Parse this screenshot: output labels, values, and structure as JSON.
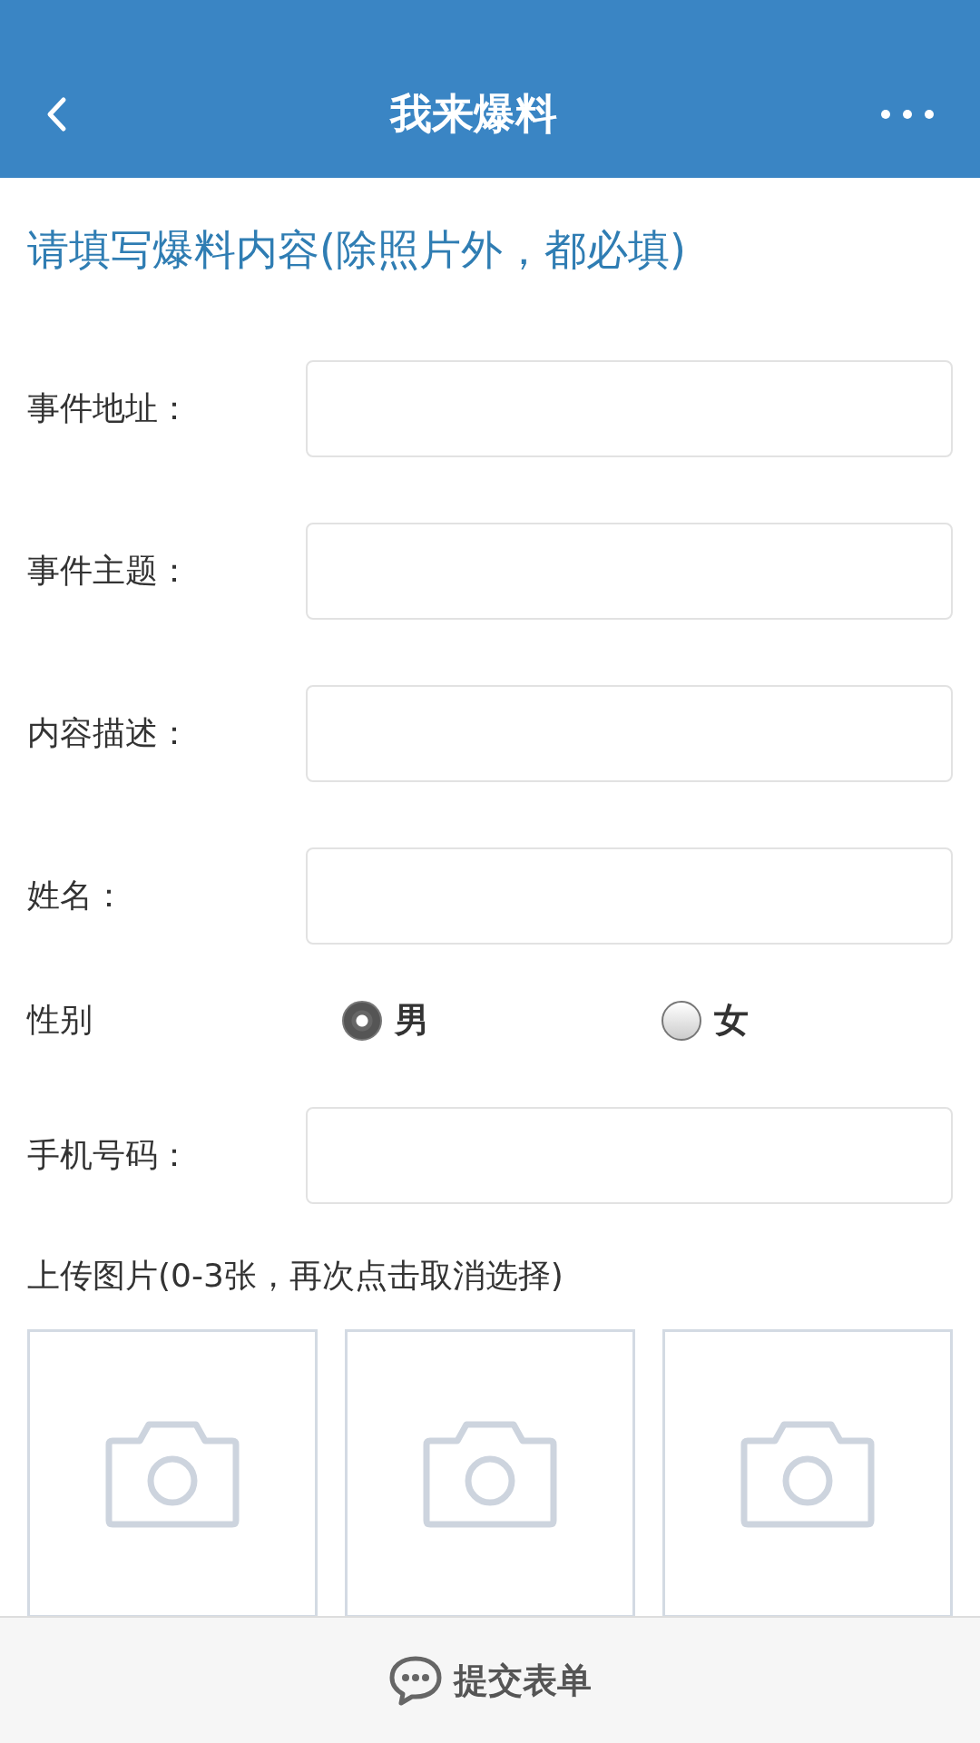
{
  "header": {
    "title": "我来爆料"
  },
  "form": {
    "heading": "请填写爆料内容(除照片外，都必填)",
    "fields": [
      {
        "kind": "text",
        "label": "事件地址："
      },
      {
        "kind": "text",
        "label": "事件主题："
      },
      {
        "kind": "text",
        "label": "内容描述："
      },
      {
        "kind": "text",
        "label": "姓名："
      },
      {
        "kind": "radio",
        "label": "性别",
        "options": [
          {
            "label": "男",
            "selected": true
          },
          {
            "label": "女",
            "selected": false
          }
        ]
      },
      {
        "kind": "text",
        "label": "手机号码："
      }
    ],
    "upload": {
      "label": "上传图片(0-3张，再次点击取消选择)",
      "slots": [
        {
          "kind": "camera"
        },
        {
          "kind": "camera"
        },
        {
          "kind": "camera"
        }
      ]
    }
  },
  "footer": {
    "submit": "提交表单"
  }
}
